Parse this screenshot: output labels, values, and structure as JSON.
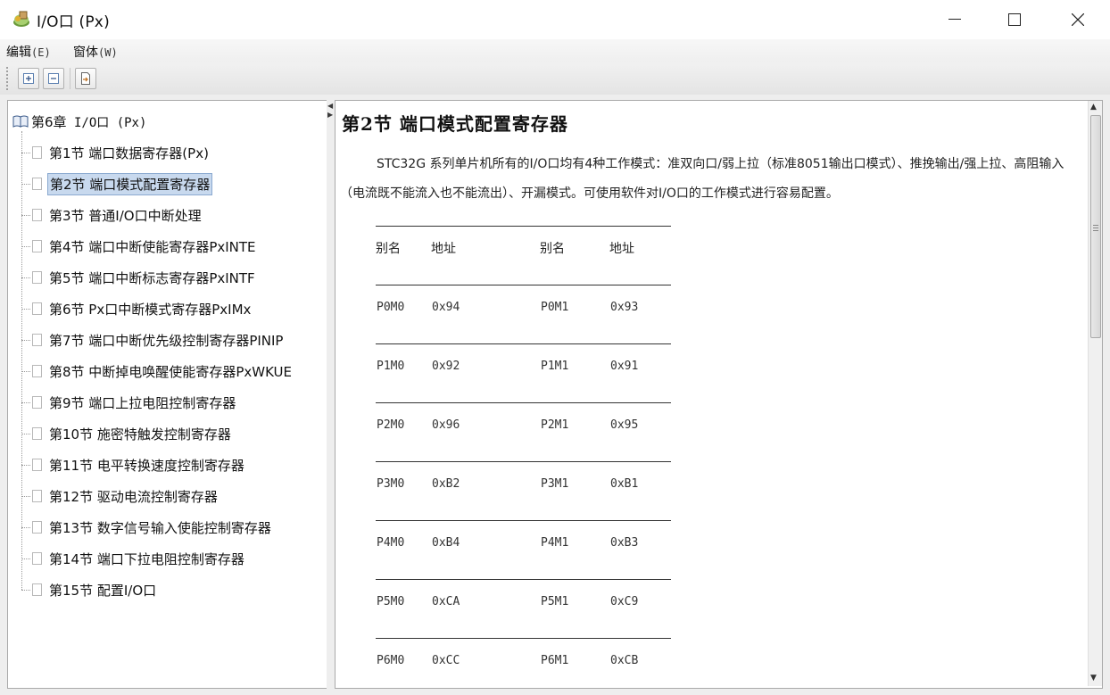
{
  "window": {
    "title": "I/O口 (Px)"
  },
  "menu": [
    {
      "label": "编辑",
      "accel": "(E)"
    },
    {
      "label": "窗体",
      "accel": "(W)"
    }
  ],
  "toolbar": {
    "buttons": [
      "expand-all",
      "collapse-all",
      "export"
    ]
  },
  "tree": {
    "root": {
      "prefix": "第6章",
      "rest": " I/O口 (Px)"
    },
    "items": [
      "第1节 端口数据寄存器(Px)",
      "第2节 端口模式配置寄存器",
      "第3节 普通I/O口中断处理",
      "第4节 端口中断使能寄存器PxINTE",
      "第5节 端口中断标志寄存器PxINTF",
      "第6节 Px口中断模式寄存器PxIMx",
      "第7节 端口中断优先级控制寄存器PINIP",
      "第8节 中断掉电唤醒使能寄存器PxWKUE",
      "第9节 端口上拉电阻控制寄存器",
      "第10节 施密特触发控制寄存器",
      "第11节 电平转换速度控制寄存器",
      "第12节 驱动电流控制寄存器",
      "第13节 数字信号输入使能控制寄存器",
      "第14节 端口下拉电阻控制寄存器",
      "第15节 配置I/O口"
    ],
    "selected_index": 1
  },
  "content": {
    "title": "第2节 端口模式配置寄存器",
    "paragraph": "STC32G 系列单片机所有的I/O口均有4种工作模式：准双向口/弱上拉（标准8051输出口模式）、推挽输出/强上拉、高阻输入（电流既不能流入也不能流出）、开漏模式。可使用软件对I/O口的工作模式进行容易配置。",
    "table": {
      "headers": [
        "别名",
        "地址",
        "别名",
        "地址"
      ],
      "rows": [
        [
          "P0M0",
          "0x94",
          "P0M1",
          "0x93"
        ],
        [
          "P1M0",
          "0x92",
          "P1M1",
          "0x91"
        ],
        [
          "P2M0",
          "0x96",
          "P2M1",
          "0x95"
        ],
        [
          "P3M0",
          "0xB2",
          "P3M1",
          "0xB1"
        ],
        [
          "P4M0",
          "0xB4",
          "P4M1",
          "0xB3"
        ],
        [
          "P5M0",
          "0xCA",
          "P5M1",
          "0xC9"
        ],
        [
          "P6M0",
          "0xCC",
          "P6M1",
          "0xCB"
        ]
      ]
    }
  },
  "colors": {
    "selection": "#c8d9ee",
    "chrome": "#eeeeee"
  }
}
